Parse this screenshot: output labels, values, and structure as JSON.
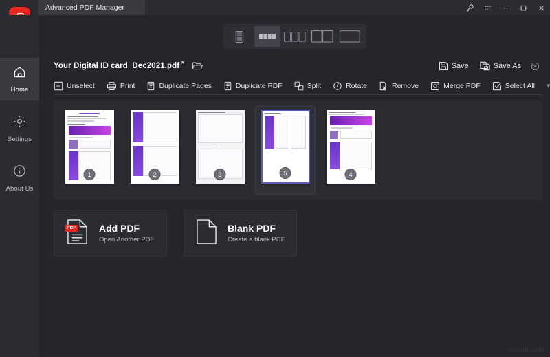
{
  "window": {
    "title": "Advanced PDF Manager",
    "controls": [
      {
        "name": "key-icon",
        "label": "Key"
      },
      {
        "name": "menu-icon",
        "label": "Menu"
      },
      {
        "name": "minimize-icon",
        "label": "Minimize"
      },
      {
        "name": "maximize-icon",
        "label": "Maximize"
      },
      {
        "name": "close-icon",
        "label": "Close"
      }
    ]
  },
  "colors": {
    "accent_red": "#ef2a24",
    "window_bg": "#25262b",
    "panel_bg": "#2b2c31",
    "selection_border": "#5b5fae",
    "text": "#e8e8ec"
  },
  "sidebar": {
    "items": [
      {
        "label": "Home",
        "icon": "home-icon",
        "active": true
      },
      {
        "label": "Settings",
        "icon": "gear-icon",
        "active": false
      },
      {
        "label": "About Us",
        "icon": "info-icon",
        "active": false
      }
    ]
  },
  "view_modes": {
    "selected_index": 1,
    "items": [
      {
        "name": "view-mode-scroll",
        "label": "Continuous scroll"
      },
      {
        "name": "view-mode-grid-4",
        "label": "Four page grid"
      },
      {
        "name": "view-mode-3up",
        "label": "Three pages"
      },
      {
        "name": "view-mode-2up",
        "label": "Two pages"
      },
      {
        "name": "view-mode-1up",
        "label": "Single page"
      }
    ]
  },
  "file": {
    "name": "Your Digital ID card_Dec2021.pdf",
    "modified_marker": "*",
    "open_icon": "open-folder-icon",
    "save_label": "Save",
    "save_as_label": "Save As",
    "close_icon": "close-file-icon"
  },
  "toolbar": {
    "more_label": "▾",
    "items": [
      {
        "label": "Unselect",
        "icon": "unselect-icon"
      },
      {
        "label": "Print",
        "icon": "printer-icon"
      },
      {
        "label": "Duplicate Pages",
        "icon": "duplicate-pages-icon"
      },
      {
        "label": "Duplicate PDF",
        "icon": "duplicate-pdf-icon"
      },
      {
        "label": "Split",
        "icon": "split-icon"
      },
      {
        "label": "Rotate",
        "icon": "rotate-icon"
      },
      {
        "label": "Remove",
        "icon": "remove-icon"
      },
      {
        "label": "Merge PDF",
        "icon": "merge-pdf-icon"
      },
      {
        "label": "Select All",
        "icon": "select-all-icon"
      }
    ]
  },
  "pages": [
    {
      "badge": "1",
      "selected": false,
      "style": "form-letter"
    },
    {
      "badge": "2",
      "selected": false,
      "style": "two-panel"
    },
    {
      "badge": "3",
      "selected": false,
      "style": "list-form"
    },
    {
      "badge": "5",
      "selected": true,
      "style": "single-panel"
    },
    {
      "badge": "4",
      "selected": false,
      "style": "form-letter"
    }
  ],
  "actions": [
    {
      "title": "Add PDF",
      "subtitle": "Open Another PDF",
      "icon": "pdf-file-icon"
    },
    {
      "title": "Blank PDF",
      "subtitle": "Create a blank PDF",
      "icon": "blank-page-icon"
    }
  ],
  "watermark": "wsxdn.com"
}
